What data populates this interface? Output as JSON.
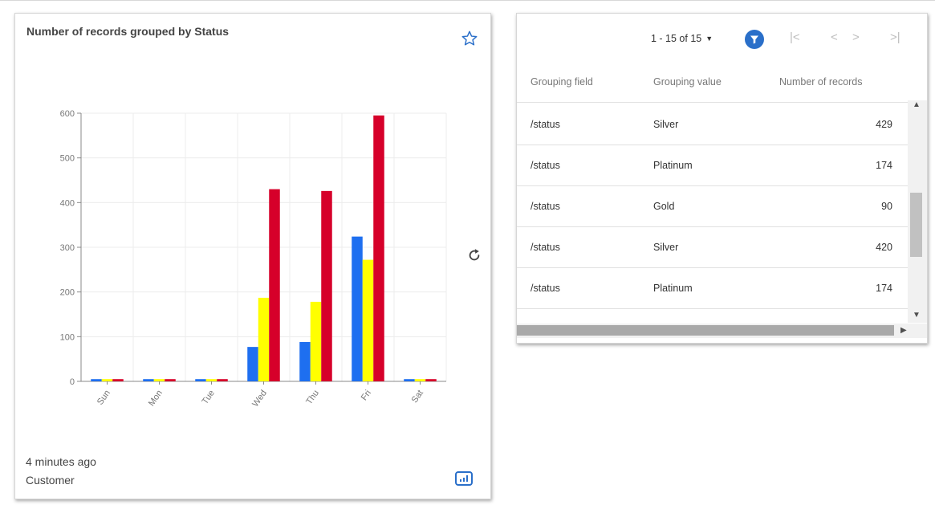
{
  "chart_card": {
    "title": "Number of records grouped by Status",
    "updated": "4 minutes ago",
    "entity": "Customer"
  },
  "chart_data": {
    "type": "bar",
    "categories": [
      "Sun",
      "Mon",
      "Tue",
      "Wed",
      "Thu",
      "Fri",
      "Sat"
    ],
    "series": [
      {
        "values": [
          5,
          5,
          5,
          77,
          88,
          324,
          5
        ],
        "color": "#1e6ff0"
      },
      {
        "values": [
          5,
          5,
          5,
          187,
          178,
          272,
          5
        ],
        "color": "#ffff00"
      },
      {
        "values": [
          5,
          5,
          5,
          430,
          426,
          595,
          5
        ],
        "color": "#d6002a"
      }
    ],
    "ylim": [
      0,
      600
    ],
    "yticks": [
      "0",
      "100",
      "200",
      "300",
      "400",
      "500",
      "600"
    ],
    "grid": true,
    "legend": "none"
  },
  "table_card": {
    "pager": {
      "range": "1 - 15 of 15",
      "first": "|<",
      "prev": "<",
      "next": ">",
      "last": ">|"
    },
    "columns": [
      "Grouping field",
      "Grouping value",
      "Number of records"
    ],
    "rows": [
      {
        "field": "/status",
        "value": "Silver",
        "count": "429"
      },
      {
        "field": "/status",
        "value": "Platinum",
        "count": "174"
      },
      {
        "field": "/status",
        "value": "Gold",
        "count": "90"
      },
      {
        "field": "/status",
        "value": "Silver",
        "count": "420"
      },
      {
        "field": "/status",
        "value": "Platinum",
        "count": "174"
      }
    ]
  },
  "icons": {
    "star": "star-outline-icon",
    "refresh": "refresh-icon",
    "filter": "filter-icon",
    "chart_type": "bar-chart-icon"
  },
  "colors": {
    "accent": "#2a6fc9"
  }
}
